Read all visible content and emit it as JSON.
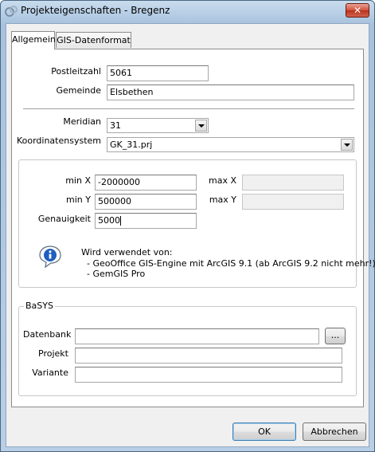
{
  "window": {
    "title": "Projekteigenschaften - Bregenz",
    "close_glyph": "✕",
    "app_icon": "geooffice-logo-icon"
  },
  "tabs": [
    {
      "label": "Allgemein",
      "active": true
    },
    {
      "label": "GIS-Datenformat",
      "active": false
    }
  ],
  "general": {
    "postleitzahl_label": "Postleitzahl",
    "postleitzahl_value": "5061",
    "gemeinde_label": "Gemeinde",
    "gemeinde_value": "Elsbethen",
    "meridian_label": "Meridian",
    "meridian_value": "31",
    "koordinatensystem_label": "Koordinatensystem",
    "koordinatensystem_value": "GK_31.prj"
  },
  "extent": {
    "min_x_label": "min X",
    "min_x_value": "-2000000",
    "min_y_label": "min Y",
    "min_y_value": "500000",
    "max_x_label": "max X",
    "max_x_value": "",
    "max_y_label": "max Y",
    "max_y_value": "",
    "genauigkeit_label": "Genauigkeit",
    "genauigkeit_value": "5000",
    "info_icon": "info-icon",
    "info_heading": "Wird verwendet von:",
    "info_line1": "- GeoOffice GIS-Engine mit ArcGIS 9.1 (ab ArcGIS 9.2 nicht mehr!)",
    "info_line2": "- GemGIS Pro"
  },
  "basys": {
    "legend": "BaSYS",
    "datenbank_label": "Datenbank",
    "datenbank_value": "",
    "browse_label": "...",
    "projekt_label": "Projekt",
    "projekt_value": "",
    "variante_label": "Variante",
    "variante_value": ""
  },
  "footer": {
    "ok_label": "OK",
    "cancel_label": "Abbrechen"
  },
  "colors": {
    "title_bar": "#b9cfe6",
    "close_button": "#c94a33",
    "dialog_bg": "#f0f0f0",
    "default_button_border": "#3c7fb1"
  }
}
